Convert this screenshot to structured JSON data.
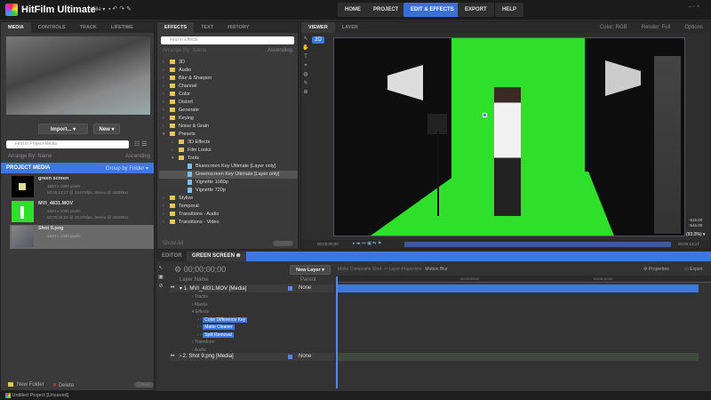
{
  "app": {
    "title": "HitFilm Ultimate",
    "menu": "File ▾",
    "status": "Untitled Project  [Unsaved]"
  },
  "nav": [
    "HOME",
    "PROJECT",
    "EDIT & EFFECTS",
    "EXPORT",
    "HELP"
  ],
  "window_controls": "– ▫ ×",
  "media_panel": {
    "tabs": [
      "MEDIA",
      "CONTROLS",
      "TRACK",
      "LIFETIME"
    ],
    "import": "Import...",
    "new": "New",
    "search_placeholder": "Find in Project Media",
    "arrange": "Arrange By: Name",
    "order": "Ascending",
    "header": "PROJECT MEDIA",
    "group": "Group by Folder ▾",
    "items": [
      {
        "name": "green screen",
        "l1": "1920 x 1080 pixels",
        "l2": "00;00;13;17 @ 23.976fps, Stereo @ 48000Hz"
      },
      {
        "name": "MVI_4831.MOV",
        "l1": "1920 x 1080 pixels",
        "l2": "00;00;44;23 @ 23.976fps, Stereo @ 48000Hz"
      },
      {
        "name": "Shot 9.png",
        "l1": "1920 x 1080 pixels",
        "l2": ""
      }
    ],
    "new_folder": "New Folder",
    "delete": "Delete",
    "clean": "Clean"
  },
  "effects_panel": {
    "tabs": [
      "EFFECTS",
      "TEXT",
      "HISTORY"
    ],
    "search_placeholder": "Find in Effects",
    "arrange": "Arrange By: Name",
    "order": "Ascending",
    "tree": [
      {
        "label": "3D",
        "type": "folder",
        "level": 0
      },
      {
        "label": "Audio",
        "type": "folder",
        "level": 0
      },
      {
        "label": "Blur & Sharpen",
        "type": "folder",
        "level": 0
      },
      {
        "label": "Channel",
        "type": "folder",
        "level": 0
      },
      {
        "label": "Color",
        "type": "folder",
        "level": 0
      },
      {
        "label": "Distort",
        "type": "folder",
        "level": 0
      },
      {
        "label": "Generate",
        "type": "folder",
        "level": 0
      },
      {
        "label": "Keying",
        "type": "folder",
        "level": 0
      },
      {
        "label": "Noise & Grain",
        "type": "folder",
        "level": 0
      },
      {
        "label": "Presets",
        "type": "folder",
        "level": 0,
        "open": true
      },
      {
        "label": "3D Effects",
        "type": "folder",
        "level": 1
      },
      {
        "label": "Film Looks",
        "type": "folder",
        "level": 1
      },
      {
        "label": "Tools",
        "type": "folder",
        "level": 1,
        "open": true
      },
      {
        "label": "Bluescreen Key Ultimate [Layer only]",
        "type": "file",
        "level": 2
      },
      {
        "label": "Greenscreen Key Ultimate [Layer only]",
        "type": "file",
        "level": 2,
        "selected": true
      },
      {
        "label": "Vignette 1080p",
        "type": "file",
        "level": 2
      },
      {
        "label": "Vignette 720p",
        "type": "file",
        "level": 2
      },
      {
        "label": "Stylize",
        "type": "folder",
        "level": 0
      },
      {
        "label": "Temporal",
        "type": "folder",
        "level": 0
      },
      {
        "label": "Transitions - Audio",
        "type": "folder",
        "level": 0
      },
      {
        "label": "Transitions - Video",
        "type": "folder",
        "level": 0
      }
    ],
    "show": "Show All",
    "new_folder": "Folder"
  },
  "viewer": {
    "tabs": [
      "VIEWER",
      "LAYER"
    ],
    "mode": "2D",
    "color": "Color: RGB",
    "render": "Render: Full",
    "options": "Options",
    "time_start": "00;00;00;00",
    "time_end": "00;00;13;17",
    "x": "-519.00",
    "y": "-545.00",
    "zoom": "(93.0%) ▾"
  },
  "timeline": {
    "tabs": [
      "EDITOR",
      "GREEN SCREEN"
    ],
    "timecode": "00;00;00;00",
    "new_layer": "New Layer",
    "make_comp": "Make Composite Shot",
    "layer_props": "Layer Properties",
    "motion_blur": "Motion Blur",
    "properties": "Properties",
    "export": "Export",
    "layer_name": "Layer Name",
    "parent": "Parent",
    "ruler": [
      "00;00;05;00",
      "00;00;10;00"
    ],
    "layers": [
      {
        "label": "1. MVI_4831.MOV [Media]",
        "parent": "None"
      },
      {
        "label": "2. Shot 9.png [Media]",
        "parent": "None"
      }
    ],
    "sub": [
      "Tracks",
      "Masks",
      "Effects",
      "Transform",
      "Audio"
    ],
    "effects": [
      "Color Difference Key",
      "Matte Cleaner",
      "Spill Removal"
    ]
  },
  "colors": {
    "accent": "#3d78e0",
    "green": "#2ee02a"
  }
}
